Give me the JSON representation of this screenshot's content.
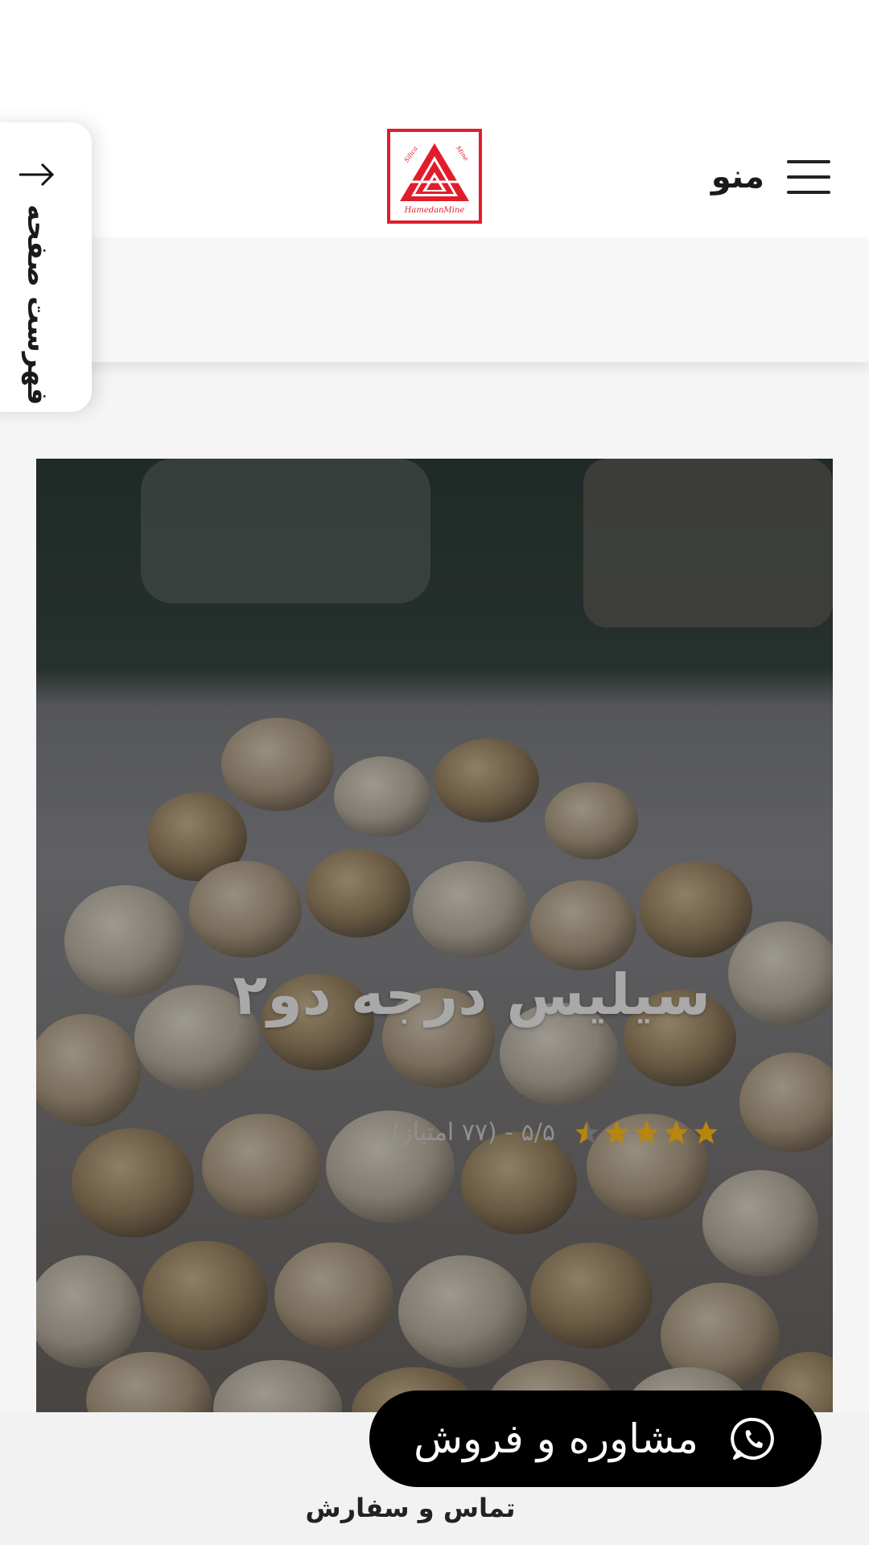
{
  "header": {
    "menu_label": "منو",
    "logo_alt": "HamedanMine Silica Mine logo",
    "logo_text_top_left": "Silica",
    "logo_text_top_right": "Mine",
    "logo_text_bottom": "HamedanMine",
    "brand_color": "#e11d2c"
  },
  "toc": {
    "label": "فهرست صفحه",
    "icon": "arrow-right-icon"
  },
  "hero": {
    "title": "سیلیس درجه دو۲",
    "rating": {
      "stars": 4.5,
      "max": 5,
      "text": "۵/۵ - (۷۷ امتیاز)"
    },
    "star_color": "#b8860b"
  },
  "bottom": {
    "consult_button": "مشاوره و فروش",
    "consult_icon": "whatsapp-icon",
    "contact_label": "تماس و سفارش"
  }
}
